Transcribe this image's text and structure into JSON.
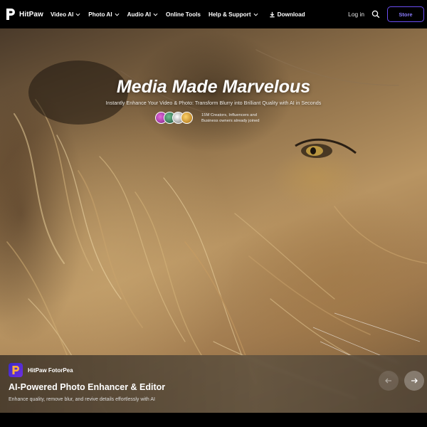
{
  "nav": {
    "brand": "HitPaw",
    "items": [
      {
        "label": "Video AI",
        "has_dropdown": true
      },
      {
        "label": "Photo AI",
        "has_dropdown": true
      },
      {
        "label": "Audio AI",
        "has_dropdown": true
      },
      {
        "label": "Online Tools",
        "has_dropdown": false
      },
      {
        "label": "Help & Support",
        "has_dropdown": true
      },
      {
        "label": "Download",
        "icon": "download-icon"
      }
    ],
    "login_label": "Log in",
    "search_icon": "search-icon",
    "store_label": "Store"
  },
  "hero": {
    "title": "Media Made Marvelous",
    "subtitle": "Instantly Enhance Your Video & Photo: Transform Blurry into Brilliant Quality with AI in Seconds",
    "social_proof": "15M Creators, Influencers and Business owners already joined",
    "avatar_colors": [
      "#c53ab8",
      "#3a8a6a",
      "#f0f0f0",
      "#e8a21c"
    ]
  },
  "feature_card": {
    "app_name": "HitPaw FotorPea",
    "title": "AI-Powered Photo Enhancer & Editor",
    "description": "Enhance quality, remove blur, and revive details effortlessly with AI",
    "prev_icon": "arrow-left-icon",
    "next_icon": "arrow-right-icon"
  },
  "colors": {
    "accent": "#6b4df2",
    "nav_bg": "#000000"
  }
}
